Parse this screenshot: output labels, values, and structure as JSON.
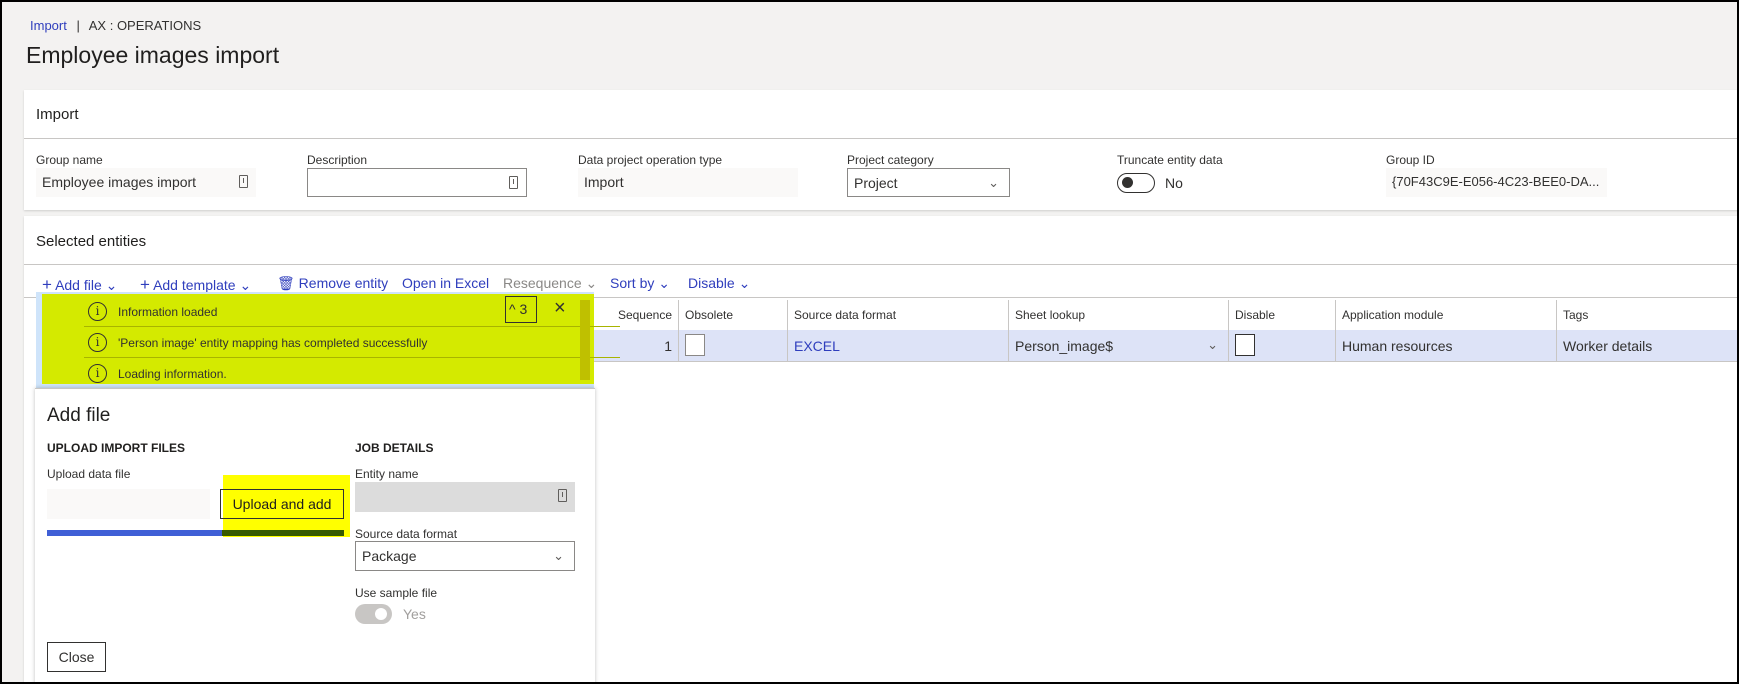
{
  "breadcrumb": {
    "link": "Import",
    "separator": "|",
    "context": "AX : OPERATIONS"
  },
  "page_title": "Employee images import",
  "import_card": {
    "title": "Import",
    "fields": {
      "group_name": {
        "label": "Group name",
        "value": "Employee images import"
      },
      "description": {
        "label": "Description",
        "value": ""
      },
      "operation_type": {
        "label": "Data project operation type",
        "value": "Import"
      },
      "project_category": {
        "label": "Project category",
        "value": "Project"
      },
      "truncate": {
        "label": "Truncate entity data",
        "value": "No",
        "on": false
      },
      "group_id": {
        "label": "Group ID",
        "value": "{70F43C9E-E056-4C23-BEE0-DA..."
      }
    }
  },
  "entities_card": {
    "title": "Selected entities",
    "toolbar": {
      "add_file": "Add file",
      "add_template": "Add template",
      "remove_entity": "Remove entity",
      "open_in_excel": "Open in Excel",
      "resequence": "Resequence",
      "sort_by": "Sort by",
      "disable": "Disable"
    },
    "columns": [
      "Sequence",
      "Obsolete",
      "Source data format",
      "Sheet lookup",
      "Disable",
      "Application module",
      "Tags"
    ],
    "rows": [
      {
        "sequence": "1",
        "obsolete": false,
        "source_format": "EXCEL",
        "sheet_lookup": "Person_image$",
        "disable": false,
        "module": "Human resources",
        "tags": "Worker details"
      }
    ]
  },
  "notifications": {
    "count": "3",
    "items": [
      "Information loaded",
      "'Person image' entity mapping has completed successfully",
      "Loading information."
    ],
    "highlight_color": "#d4ea00"
  },
  "add_file_panel": {
    "title": "Add file",
    "upload_section": "UPLOAD IMPORT FILES",
    "upload_label": "Upload data file",
    "upload_value": "",
    "upload_button": "Upload and add",
    "upload_progress_percent": 100,
    "job_section": "JOB DETAILS",
    "entity_name_label": "Entity name",
    "entity_name_value": "",
    "source_format_label": "Source data format",
    "source_format_value": "Package",
    "sample_label": "Use sample file",
    "sample_value": "Yes",
    "close_button": "Close"
  },
  "colors": {
    "accent": "#2f3ebd",
    "row_selected": "#dde3f7",
    "highlight": "#ffff00"
  }
}
